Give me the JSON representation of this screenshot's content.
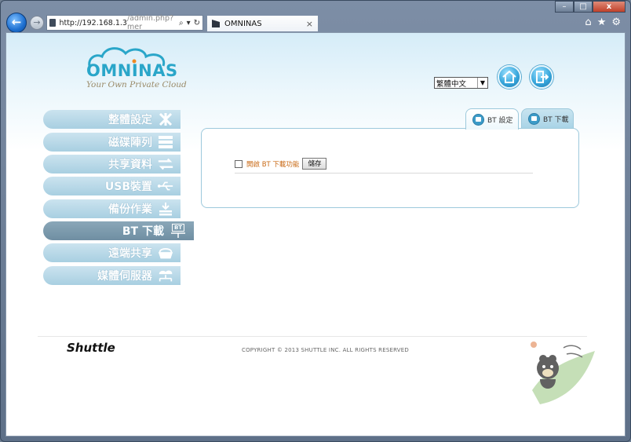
{
  "browser": {
    "url_host": "http://192.168.1.3",
    "url_path": "/admin.php?mer",
    "tab_title": "OMNINAS",
    "tab_close": "×",
    "address_tools": [
      "⌕",
      "▾",
      "↻"
    ],
    "window_buttons": {
      "minimize": "–",
      "maximize": "□",
      "close": "x"
    },
    "chrome_icons": [
      "⌂",
      "★",
      "⚙"
    ]
  },
  "header": {
    "logo_text": "OMNINAS",
    "tagline": "Your Own Private Cloud",
    "language": {
      "selected": "繁體中文"
    }
  },
  "menu": {
    "items": [
      {
        "label": "整體設定",
        "icon": "tools-icon"
      },
      {
        "label": "磁碟陣列",
        "icon": "disk-stack-icon"
      },
      {
        "label": "共享資料",
        "icon": "share-arrows-icon"
      },
      {
        "label": "USB裝置",
        "icon": "usb-icon"
      },
      {
        "label": "備份作業",
        "icon": "backup-icon"
      },
      {
        "label": "BT 下載",
        "icon": "bt-icon",
        "active": true,
        "badge": "BT"
      },
      {
        "label": "遠端共享",
        "icon": "remote-basket-icon"
      },
      {
        "label": "媒體伺服器",
        "icon": "media-server-icon"
      }
    ]
  },
  "panel": {
    "tabs": [
      {
        "label": "BT 設定",
        "active": true
      },
      {
        "label": "BT 下載",
        "active": false
      }
    ],
    "enable_label": "開啟 BT 下載功能",
    "enable_checked": false,
    "save_label": "儲存"
  },
  "footer": {
    "brand": "Shuttle",
    "copyright": "COPYRIGHT © 2013 SHUTTLE INC. ALL RIGHTS RESERVED"
  },
  "colors": {
    "accent": "#2aa6c9",
    "menu_bg": "#a8cfe1",
    "menu_active": "#6f8ea2",
    "enable_label": "#c96a16"
  }
}
